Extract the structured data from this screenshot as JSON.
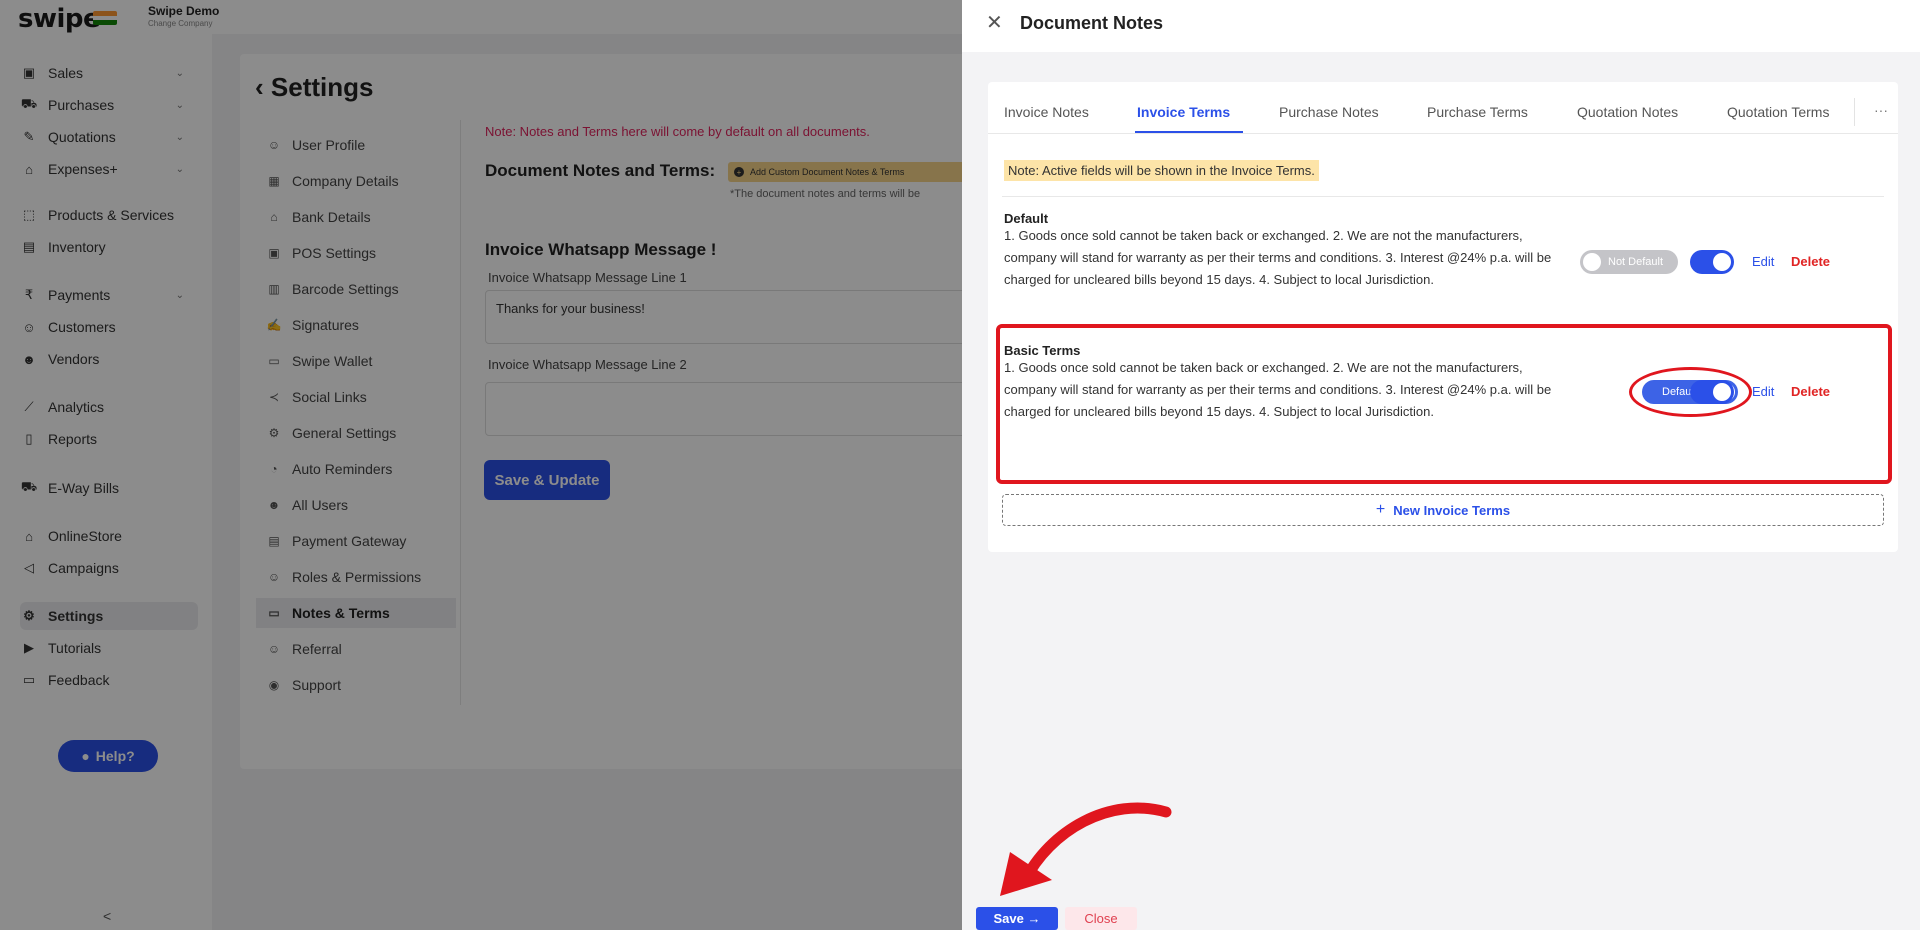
{
  "brand": {
    "logo_text": "swipe",
    "company_name": "Swipe Demo",
    "company_sub": "Change Company"
  },
  "sidebar": {
    "items": [
      {
        "label": "Sales",
        "icon": "receipt-icon",
        "chevron": true
      },
      {
        "label": "Purchases",
        "icon": "cart-icon",
        "chevron": true
      },
      {
        "label": "Quotations",
        "icon": "pen-icon",
        "chevron": true
      },
      {
        "label": "Expenses+",
        "icon": "tag-icon",
        "chevron": true
      },
      {
        "label": "Products & Services",
        "icon": "box-icon",
        "chevron": false
      },
      {
        "label": "Inventory",
        "icon": "inventory-icon",
        "chevron": false
      },
      {
        "label": "Payments",
        "icon": "rupee-icon",
        "chevron": true
      },
      {
        "label": "Customers",
        "icon": "user-icon",
        "chevron": false
      },
      {
        "label": "Vendors",
        "icon": "users-icon",
        "chevron": false
      },
      {
        "label": "Analytics",
        "icon": "chart-icon",
        "chevron": false
      },
      {
        "label": "Reports",
        "icon": "report-icon",
        "chevron": false
      },
      {
        "label": "E-Way Bills",
        "icon": "truck-icon",
        "chevron": false
      },
      {
        "label": "OnlineStore",
        "icon": "store-icon",
        "chevron": false
      },
      {
        "label": "Campaigns",
        "icon": "megaphone-icon",
        "chevron": false
      },
      {
        "label": "Settings",
        "icon": "gear-icon",
        "chevron": false,
        "active": true
      },
      {
        "label": "Tutorials",
        "icon": "youtube-icon",
        "chevron": false
      },
      {
        "label": "Feedback",
        "icon": "chat-icon",
        "chevron": false
      }
    ],
    "help_label": "Help?",
    "collapse_glyph": "<"
  },
  "settings": {
    "title": "Settings",
    "menu": [
      {
        "label": "User Profile",
        "icon": "user-icon"
      },
      {
        "label": "Company Details",
        "icon": "building-icon"
      },
      {
        "label": "Bank Details",
        "icon": "bank-icon"
      },
      {
        "label": "POS Settings",
        "icon": "pos-icon"
      },
      {
        "label": "Barcode Settings",
        "icon": "barcode-icon"
      },
      {
        "label": "Signatures",
        "icon": "signature-icon"
      },
      {
        "label": "Swipe Wallet",
        "icon": "wallet-icon"
      },
      {
        "label": "Social Links",
        "icon": "share-icon"
      },
      {
        "label": "General Settings",
        "icon": "gear-icon"
      },
      {
        "label": "Auto Reminders",
        "icon": "bell-icon"
      },
      {
        "label": "All Users",
        "icon": "users-icon"
      },
      {
        "label": "Payment Gateway",
        "icon": "card-icon"
      },
      {
        "label": "Roles & Permissions",
        "icon": "roles-icon"
      },
      {
        "label": "Notes & Terms",
        "icon": "notes-icon",
        "active": true
      },
      {
        "label": "Referral",
        "icon": "referral-icon"
      },
      {
        "label": "Support",
        "icon": "support-icon"
      }
    ],
    "note": "Note: Notes and Terms here will come by default on all documents.",
    "dnt_label": "Document Notes and Terms:",
    "custom_button": "Add Custom Document Notes & Terms",
    "dnt_sub": "*The document notes and terms will be",
    "wa_title": "Invoice Whatsapp Message !",
    "wa_line1_label": "Invoice Whatsapp Message Line 1",
    "wa_line1_value": "Thanks for your business!",
    "wa_line2_label": "Invoice Whatsapp Message Line 2",
    "save_update": "Save & Update"
  },
  "drawer": {
    "close_glyph": "✕",
    "title": "Document Notes",
    "tabs": [
      "Invoice Notes",
      "Invoice Terms",
      "Purchase Notes",
      "Purchase Terms",
      "Quotation Notes",
      "Quotation Terms"
    ],
    "active_tab": "Invoice Terms",
    "more_glyph": "···",
    "note": "Note: Active fields will be shown in the Invoice Terms.",
    "terms": [
      {
        "title": "Default",
        "body": "1. Goods once sold cannot be taken back or exchanged. 2. We are not the manufacturers, company will stand for warranty as per their terms and conditions. 3. Interest @24% p.a. will be charged for uncleared bills beyond 15 days. 4. Subject to local Jurisdiction.",
        "default_label": "Not Default",
        "is_default": false,
        "active": true,
        "edit": "Edit",
        "delete": "Delete"
      },
      {
        "title": "Basic Terms",
        "body": "1. Goods once sold cannot be taken back or exchanged. 2. We are not the manufacturers, company will stand for warranty as per their terms and conditions. 3. Interest @24% p.a. will be charged for uncleared bills beyond 15 days. 4. Subject to local Jurisdiction.",
        "default_label": "Default",
        "is_default": true,
        "active": true,
        "edit": "Edit",
        "delete": "Delete"
      }
    ],
    "new_terms": "New Invoice Terms",
    "save": "Save →",
    "close": "Close"
  },
  "colors": {
    "accent": "#2b50e8",
    "danger": "#e02424",
    "annotation": "#e0161e",
    "note_bg": "#fde4a8"
  }
}
